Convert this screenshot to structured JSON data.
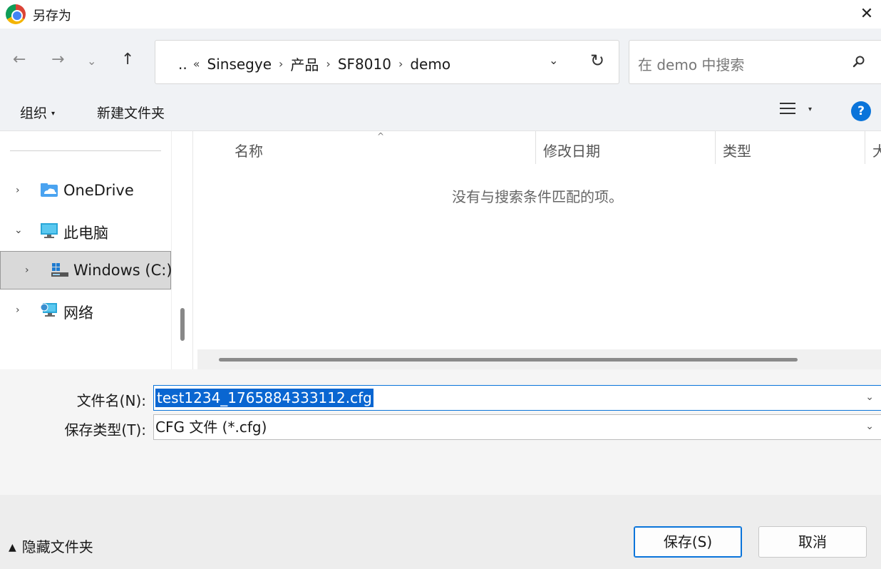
{
  "titlebar": {
    "title": "另存为",
    "app_icon": "chrome-icon",
    "close_label": "✕"
  },
  "nav": {
    "back_icon": "←",
    "forward_icon": "→",
    "recent_icon": "⌄",
    "up_icon": "↑",
    "breadcrumb": {
      "overflow": "..",
      "overflow_sep": "«",
      "items": [
        "Sinsegye",
        "产品",
        "SF8010",
        "demo"
      ],
      "sep": "›"
    },
    "dropdown_icon": "⌄",
    "refresh_icon": "↻",
    "search_placeholder": "在 demo 中搜索"
  },
  "toolbar": {
    "organize_label": "组织",
    "organize_caret": "▾",
    "new_folder_label": "新建文件夹",
    "view_caret": "▾",
    "help_label": "?"
  },
  "sidebar": {
    "items": [
      {
        "label": "OneDrive",
        "icon": "onedrive-icon",
        "chevron": "›"
      },
      {
        "label": "此电脑",
        "icon": "this-pc-icon",
        "chevron": "⌄"
      },
      {
        "label": "Windows  (C:)",
        "icon": "drive-c-icon",
        "chevron": "›",
        "selected": true
      },
      {
        "label": "网络",
        "icon": "network-icon",
        "chevron": "›"
      }
    ]
  },
  "filelist": {
    "columns": [
      "名称",
      "修改日期",
      "类型",
      "大"
    ],
    "sort_indicator": "^",
    "empty_message": "没有与搜索条件匹配的项。"
  },
  "fields": {
    "filename_label": "文件名(N):",
    "filename_value": "test1234_1765884333112.cfg",
    "filetype_label": "保存类型(T):",
    "filetype_value": "CFG 文件 (*.cfg)",
    "chevron": "⌄"
  },
  "bottom": {
    "hide_folders_icon": "▲",
    "hide_folders_label": "隐藏文件夹",
    "save_label": "保存(S)",
    "cancel_label": "取消"
  },
  "colors": {
    "accent": "#0a74da",
    "selection": "#0a66d1"
  }
}
